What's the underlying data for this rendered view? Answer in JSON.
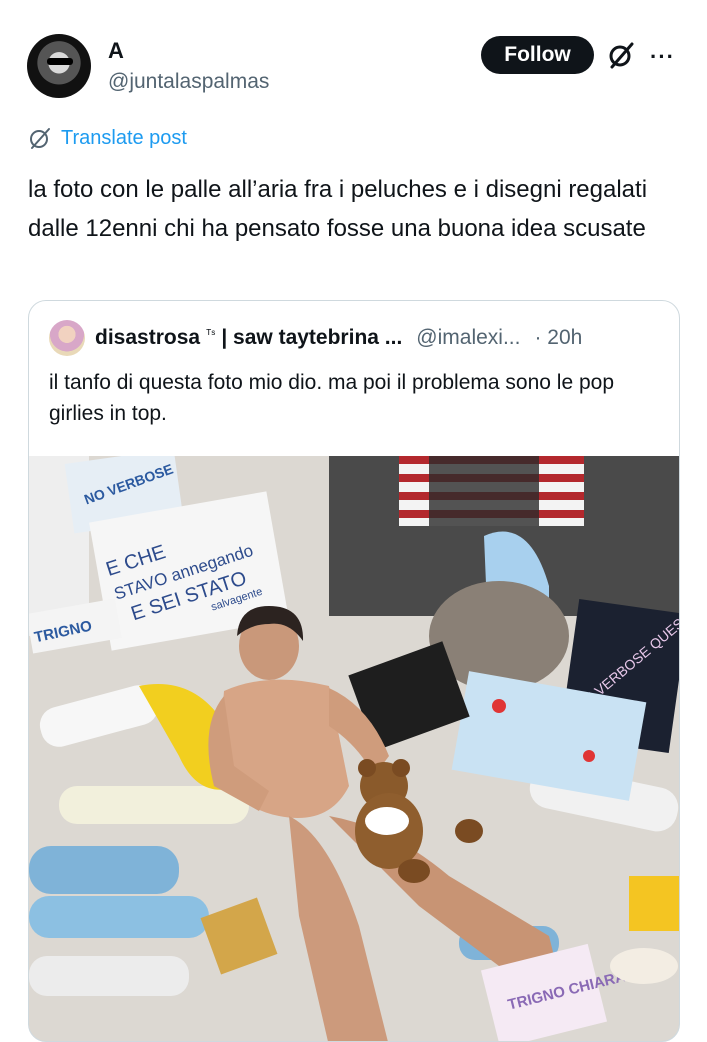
{
  "author": {
    "display_name": "A",
    "handle": "@juntalaspalmas",
    "avatar_icon": "profile-avatar"
  },
  "actions": {
    "follow_label": "Follow",
    "grok_icon": "grok-icon",
    "more_icon": "more-horizontal-icon",
    "more_glyph": "···"
  },
  "translate": {
    "label": "Translate post",
    "icon": "translate-globe-icon"
  },
  "post": {
    "text": "la foto con le palle all’aria fra i peluches e i disegni regalati dalle 12enni chi ha pensato fosse una buona idea scusate"
  },
  "quote": {
    "name": "disastrosa",
    "flair": "ᵀˢ",
    "name_suffix": "| saw taytebrina ...",
    "handle": "@imalexi...",
    "time": "· 20h",
    "text": "il tanfo di questa foto mio dio. ma poi il problema sono le pop girlies in top.",
    "photo_signs": {
      "sign1": "E CHE",
      "sign2": "STAVO annegando",
      "sign3": "E SEI STATO",
      "sign4": "salvagente",
      "corner_text": "NO VERBOSE",
      "trigno": "TRIGNO",
      "notebook": "E VERBOSE QUESA",
      "bottom_card": "TRIGNO CHIARA"
    }
  },
  "colors": {
    "follow_bg": "#0f1419",
    "link": "#1d9bf0",
    "secondary_text": "#536471",
    "border": "#cfd9de"
  }
}
